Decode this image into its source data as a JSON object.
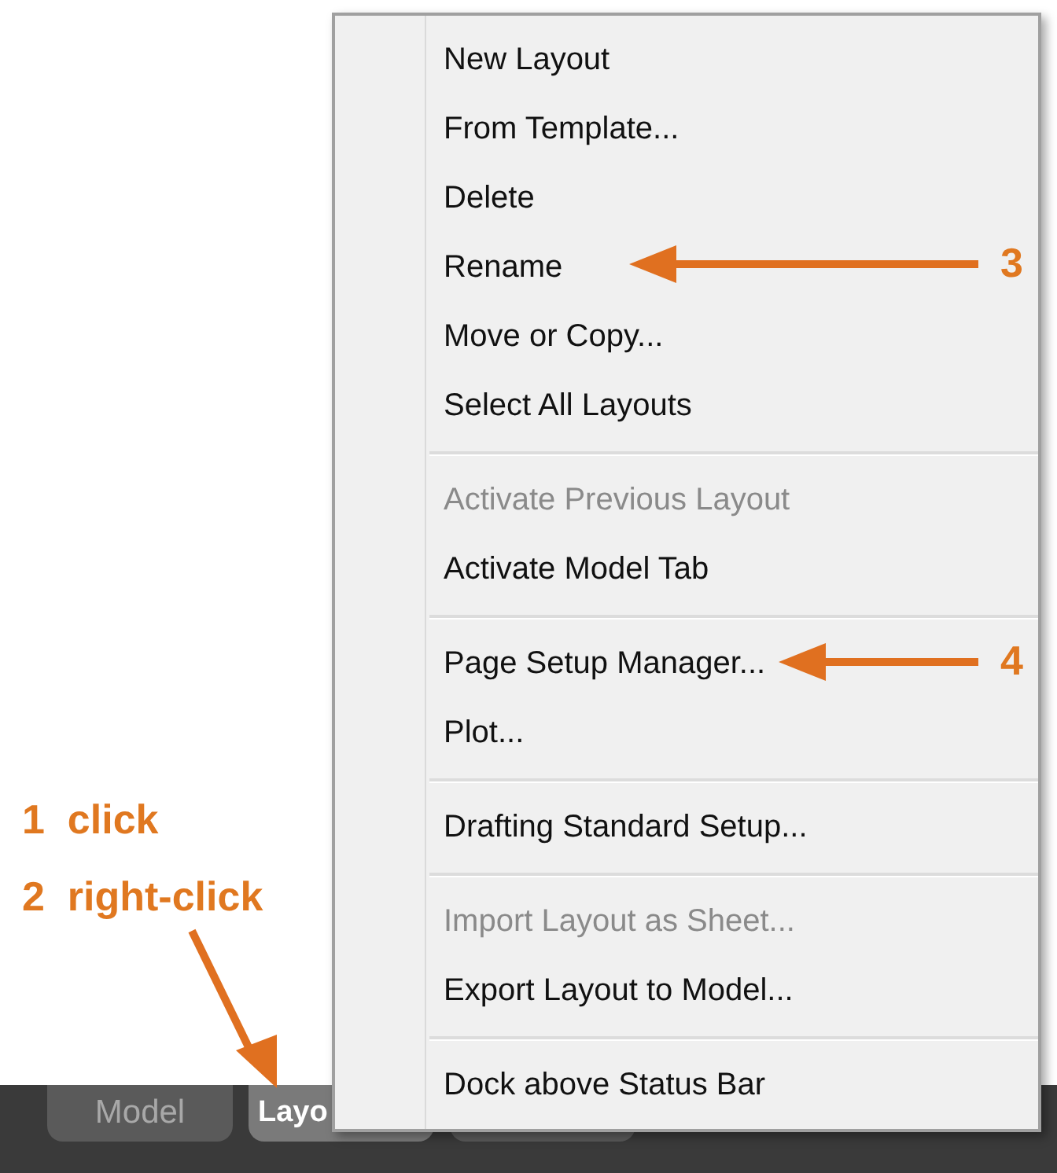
{
  "menu": {
    "items": [
      {
        "kind": "item",
        "label": "New Layout",
        "disabled": false
      },
      {
        "kind": "item",
        "label": "From Template...",
        "disabled": false
      },
      {
        "kind": "item",
        "label": "Delete",
        "disabled": false
      },
      {
        "kind": "item",
        "label": "Rename",
        "disabled": false
      },
      {
        "kind": "item",
        "label": "Move or Copy...",
        "disabled": false
      },
      {
        "kind": "item",
        "label": "Select All Layouts",
        "disabled": false
      },
      {
        "kind": "separator"
      },
      {
        "kind": "item",
        "label": "Activate Previous Layout",
        "disabled": true
      },
      {
        "kind": "item",
        "label": "Activate Model Tab",
        "disabled": false
      },
      {
        "kind": "separator"
      },
      {
        "kind": "item",
        "label": "Page Setup Manager...",
        "disabled": false
      },
      {
        "kind": "item",
        "label": "Plot...",
        "disabled": false
      },
      {
        "kind": "separator"
      },
      {
        "kind": "item",
        "label": "Drafting Standard Setup...",
        "disabled": false
      },
      {
        "kind": "separator"
      },
      {
        "kind": "item",
        "label": "Import Layout as Sheet...",
        "disabled": true
      },
      {
        "kind": "item",
        "label": "Export Layout to Model...",
        "disabled": false
      },
      {
        "kind": "separator"
      },
      {
        "kind": "item",
        "label": "Dock above Status Bar",
        "disabled": false
      }
    ]
  },
  "callouts": [
    {
      "text": "3"
    },
    {
      "text": "4"
    }
  ],
  "steps": [
    {
      "text": "1  click"
    },
    {
      "text": "2  right-click"
    }
  ],
  "tabs": [
    {
      "label": "Model",
      "selected": false
    },
    {
      "label": "Layo",
      "selected": true
    }
  ]
}
